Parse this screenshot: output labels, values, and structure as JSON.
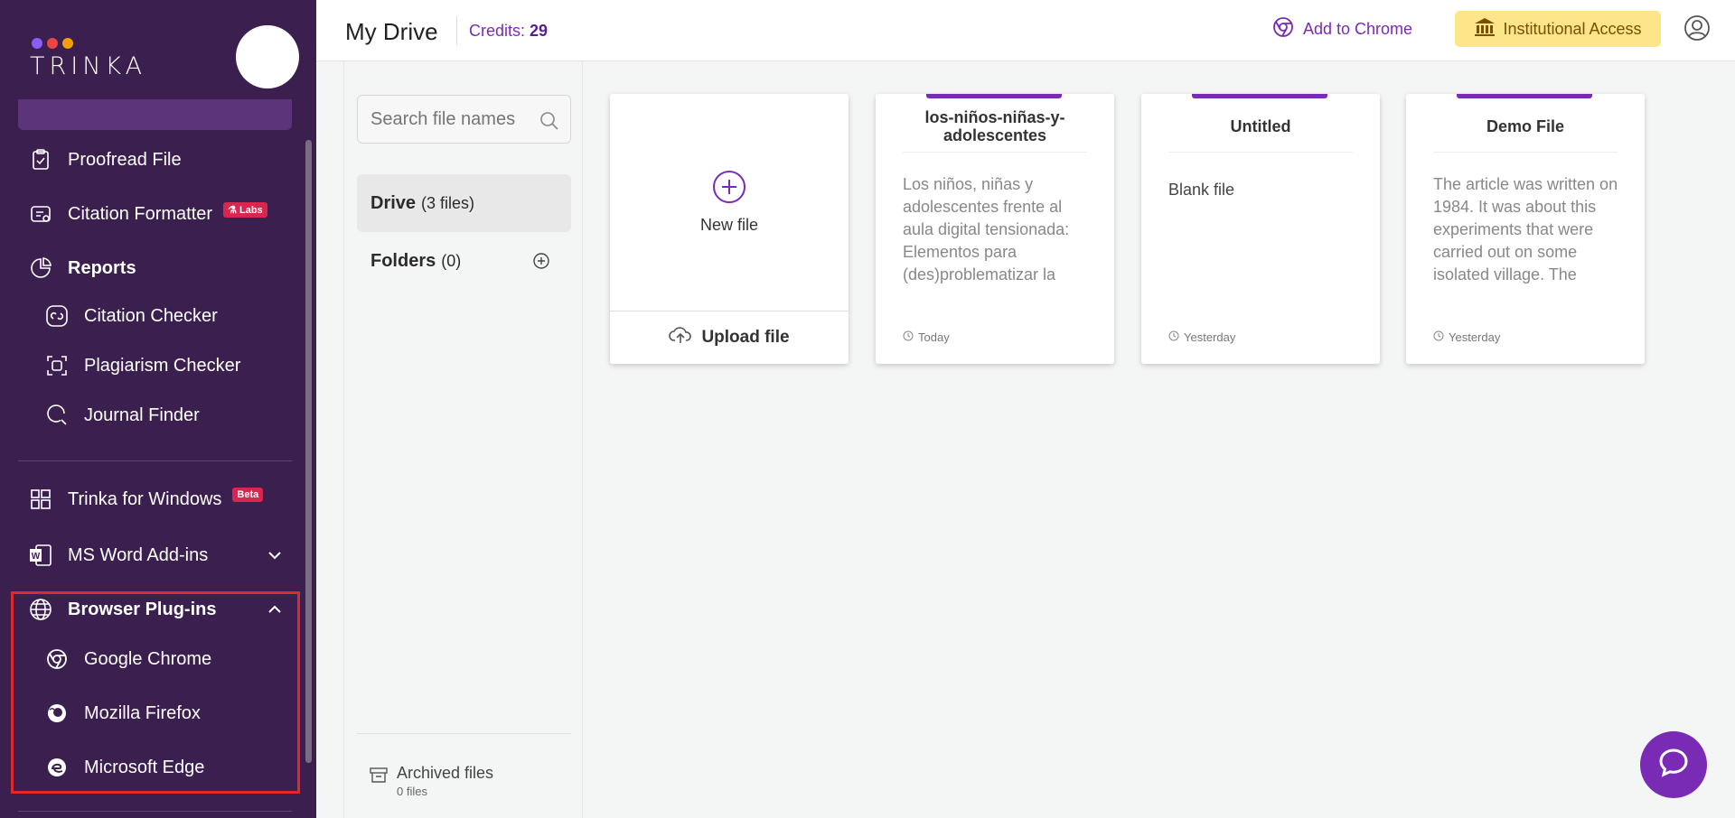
{
  "brand": {
    "name": "TRINKA",
    "dot_colors": [
      "#8b5cf6",
      "#ef4444",
      "#f59e0b"
    ]
  },
  "sidebar": {
    "items": [
      {
        "label": "Proofread File",
        "icon": "clipboard-check-icon"
      },
      {
        "label": "Citation Formatter",
        "icon": "citation-formatter-icon",
        "badge": "Labs"
      },
      {
        "label": "Reports",
        "icon": "reports-icon"
      },
      {
        "label": "Citation Checker",
        "icon": "citation-checker-icon"
      },
      {
        "label": "Plagiarism Checker",
        "icon": "plagiarism-icon"
      },
      {
        "label": "Journal Finder",
        "icon": "journal-finder-icon"
      },
      {
        "label": "Trinka for Windows",
        "icon": "windows-icon",
        "badge": "Beta"
      },
      {
        "label": "MS Word Add-ins",
        "icon": "word-icon"
      },
      {
        "label": "Browser Plug-ins",
        "icon": "globe-icon"
      },
      {
        "label": "Google Chrome",
        "icon": "chrome-icon"
      },
      {
        "label": "Mozilla Firefox",
        "icon": "firefox-icon"
      },
      {
        "label": "Microsoft Edge",
        "icon": "edge-icon"
      }
    ]
  },
  "header": {
    "title": "My Drive",
    "credits_label": "Credits:",
    "credits_value": "29",
    "add_to_chrome": "Add to Chrome",
    "institutional_access": "Institutional Access"
  },
  "drive_panel": {
    "search_placeholder": "Search file names",
    "drive_label": "Drive",
    "drive_count": "(3 files)",
    "folders_label": "Folders",
    "folders_count": "(0)",
    "archived_label": "Archived files",
    "archived_count": "0 files"
  },
  "new_card": {
    "new_label": "New file",
    "upload_label": "Upload file"
  },
  "files": [
    {
      "title": "los-niños-niñas-y-adolescentes",
      "preview": "Los niños, niñas y adolescentes frente al aula digital tensionada: Elementos para (des)problematizar la escuela Resumen El",
      "date": "Today"
    },
    {
      "title": "Untitled",
      "preview": "Blank file",
      "date": "Yesterday"
    },
    {
      "title": "Demo File",
      "preview": "The article was written on 1984. It was about this experiments that were carried out on some isolated village. The villages (Lulbushki)",
      "date": "Yesterday"
    }
  ],
  "colors": {
    "sidebar_bg": "#3b1f4f",
    "accent": "#7a2bb5",
    "institutional_bg": "#fde68a",
    "highlight": "#e0282f"
  }
}
